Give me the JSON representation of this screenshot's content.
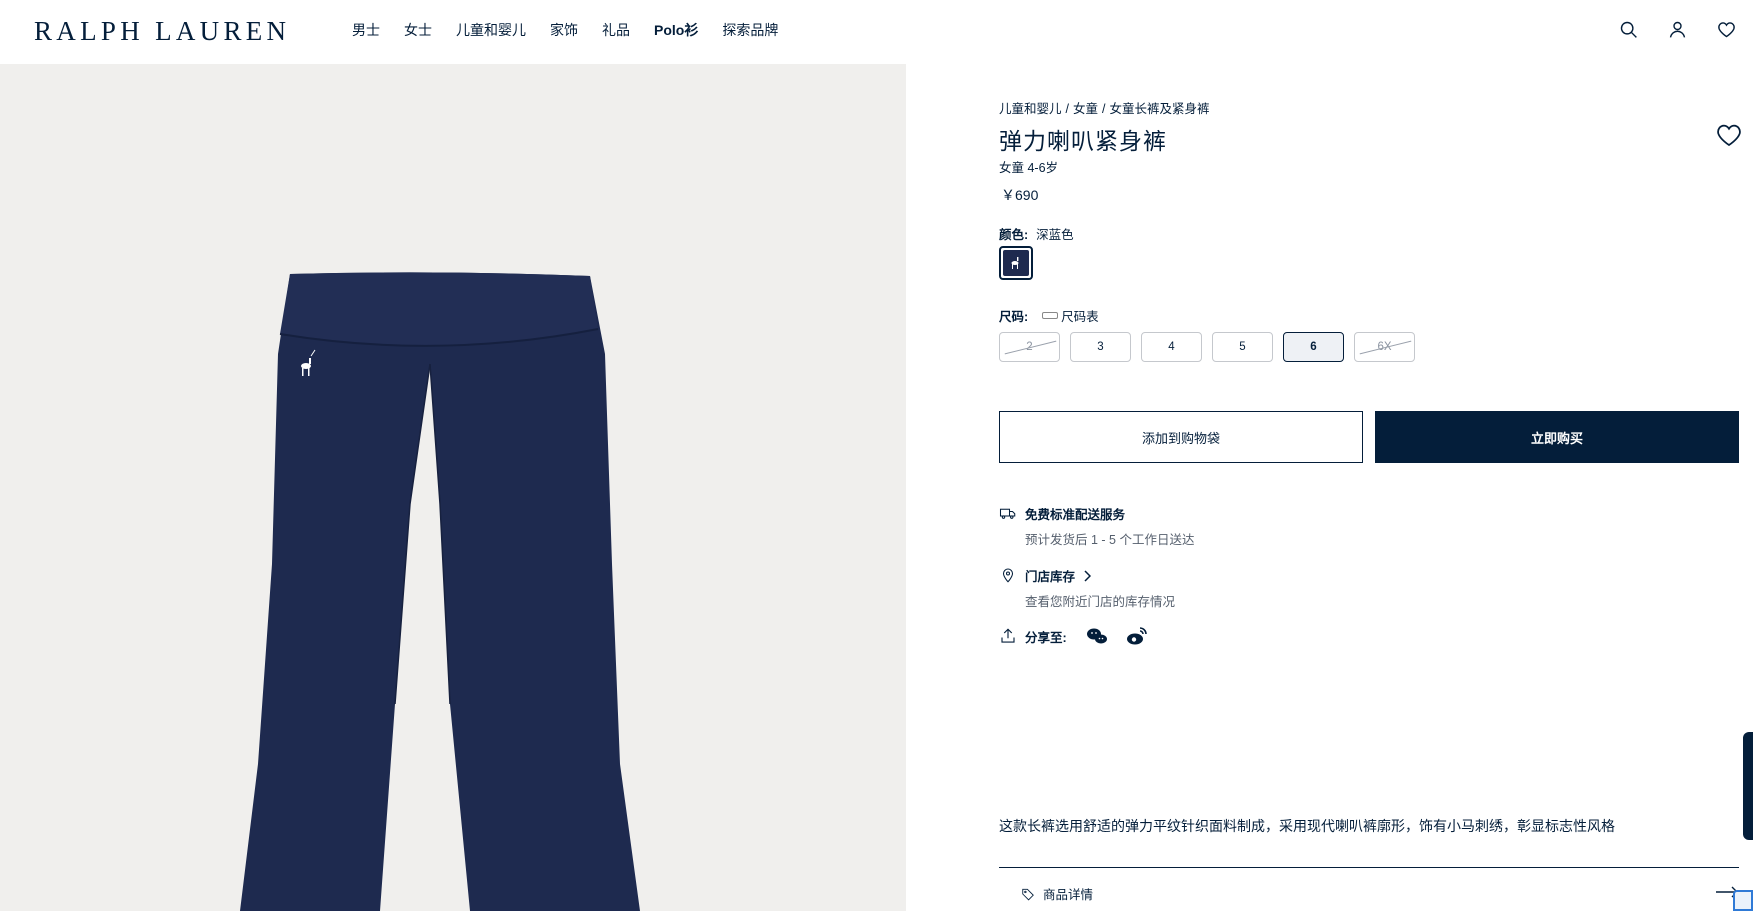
{
  "header": {
    "logo": "RALPH LAUREN",
    "nav": [
      {
        "label": "男士",
        "bold": false
      },
      {
        "label": "女士",
        "bold": false
      },
      {
        "label": "儿童和婴儿",
        "bold": false
      },
      {
        "label": "家饰",
        "bold": false
      },
      {
        "label": "礼品",
        "bold": false
      },
      {
        "label": "Polo衫",
        "bold": true
      },
      {
        "label": "探索品牌",
        "bold": false
      }
    ],
    "icons": [
      "search-icon",
      "account-icon",
      "wishlist-icon"
    ]
  },
  "product": {
    "breadcrumb": [
      "儿童和婴儿",
      "女童",
      "女童长裤及紧身裤"
    ],
    "breadcrumb_sep": "/",
    "title": "弹力喇叭紧身裤",
    "subtitle": "女童 4-6岁",
    "price": "￥690",
    "color_label": "颜色:",
    "color_value": "深蓝色",
    "size_label": "尺码:",
    "size_chart_label": "尺码表",
    "sizes": [
      {
        "label": "2",
        "state": "unavailable"
      },
      {
        "label": "3",
        "state": "available"
      },
      {
        "label": "4",
        "state": "available"
      },
      {
        "label": "5",
        "state": "available"
      },
      {
        "label": "6",
        "state": "selected"
      },
      {
        "label": "6X",
        "state": "unavailable"
      }
    ],
    "add_to_bag": "添加到购物袋",
    "buy_now": "立即购买",
    "shipping_title": "免费标准配送服务",
    "shipping_sub": "预计发货后 1 - 5 个工作日送达",
    "store_title": "门店库存",
    "store_sub": "查看您附近门店的库存情况",
    "share_label": "分享至:",
    "share_icons": [
      "wechat-icon",
      "weibo-icon"
    ],
    "description": "这款长裤选用舒适的弹力平纹针织面料制成，采用现代喇叭裤廓形，饰有小马刺绣，彰显标志性风格",
    "details_label": "商品详情"
  },
  "colors": {
    "navy": "#041e3a",
    "image_bg": "#f0efed",
    "pants": "#1e2a4f"
  }
}
